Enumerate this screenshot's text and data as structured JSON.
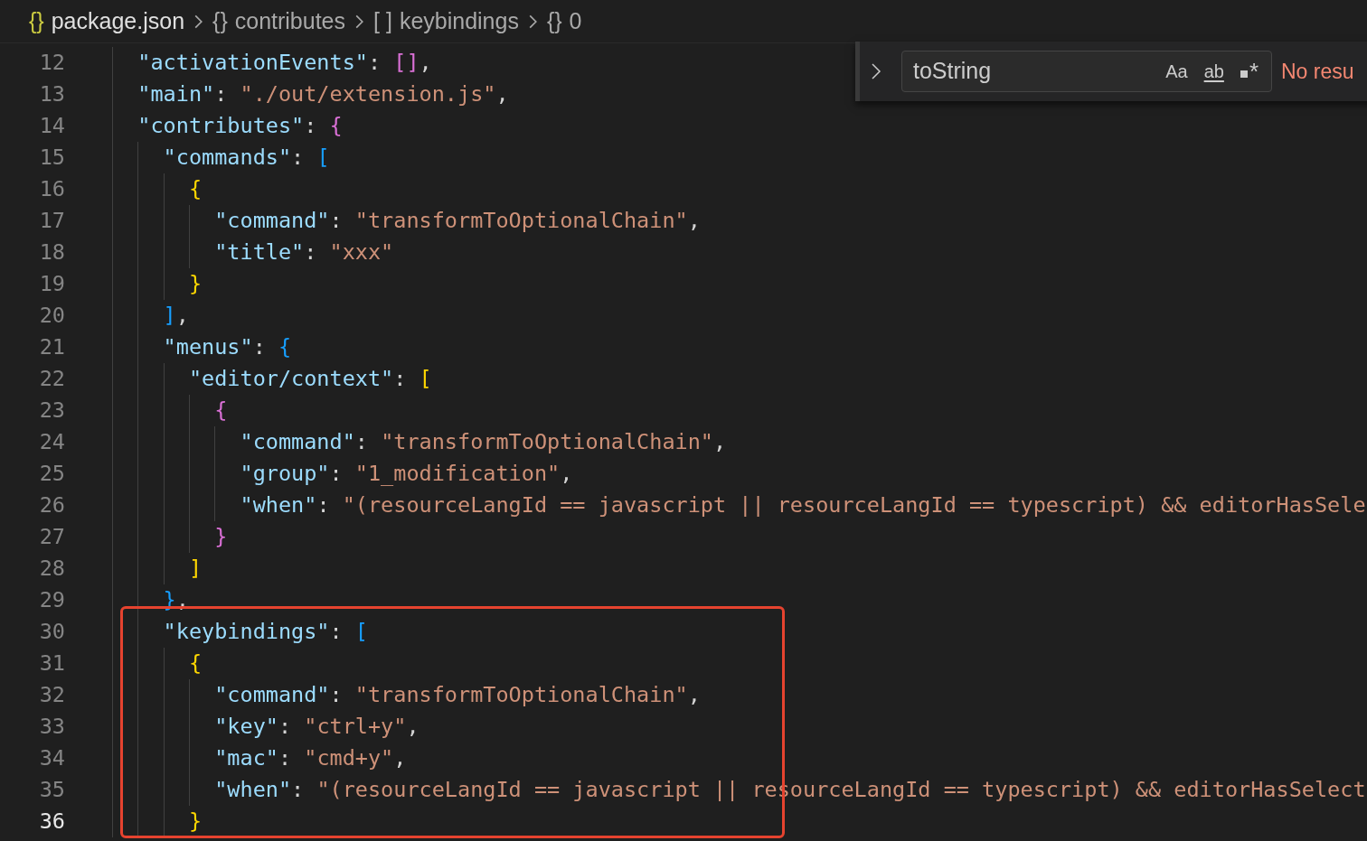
{
  "breadcrumb": [
    {
      "icon": "{}",
      "label": "package.json",
      "kind": "file"
    },
    {
      "icon": "{}",
      "label": "contributes",
      "kind": "object"
    },
    {
      "icon": "[ ]",
      "label": "keybindings",
      "kind": "array"
    },
    {
      "icon": "{}",
      "label": "0",
      "kind": "object"
    }
  ],
  "find_widget": {
    "value": "toString",
    "options": [
      {
        "label": "Aa",
        "kind": "case",
        "on": false
      },
      {
        "label": "ab",
        "kind": "word",
        "on": false
      },
      {
        "label": "*",
        "kind": "regex",
        "on": false
      }
    ],
    "status": "No resu"
  },
  "lines": [
    {
      "number": "12",
      "current": false,
      "tokens": [
        {
          "kind": "key",
          "text": "\"activationEvents\""
        },
        {
          "kind": "punct",
          "text": ": "
        },
        {
          "kind": "bracket",
          "text": "[]",
          "color": "#da70d6"
        },
        {
          "kind": "punct",
          "text": ","
        }
      ]
    },
    {
      "number": "13",
      "current": false,
      "tokens": [
        {
          "kind": "key",
          "text": "\"main\""
        },
        {
          "kind": "punct",
          "text": ": "
        },
        {
          "kind": "string",
          "text": "\"./out/extension.js\""
        },
        {
          "kind": "punct",
          "text": ","
        }
      ]
    },
    {
      "number": "14",
      "current": false,
      "tokens": [
        {
          "kind": "key",
          "text": "\"contributes\""
        },
        {
          "kind": "punct",
          "text": ": "
        },
        {
          "kind": "bracket",
          "text": "{",
          "color": "#da70d6"
        }
      ]
    },
    {
      "number": "15",
      "current": false,
      "tokens": [
        {
          "kind": "key",
          "text": "\"commands\""
        },
        {
          "kind": "punct",
          "text": ": "
        },
        {
          "kind": "bracket",
          "text": "[",
          "color": "#179fff"
        }
      ]
    },
    {
      "number": "16",
      "current": false,
      "tokens": [
        {
          "kind": "bracket",
          "text": "{",
          "color": "#ffd700"
        }
      ]
    },
    {
      "number": "17",
      "current": false,
      "tokens": [
        {
          "kind": "key",
          "text": "\"command\""
        },
        {
          "kind": "punct",
          "text": ": "
        },
        {
          "kind": "string",
          "text": "\"transformToOptionalChain\""
        },
        {
          "kind": "punct",
          "text": ","
        }
      ]
    },
    {
      "number": "18",
      "current": false,
      "tokens": [
        {
          "kind": "key",
          "text": "\"title\""
        },
        {
          "kind": "punct",
          "text": ": "
        },
        {
          "kind": "string",
          "text": "\"xxx\""
        }
      ]
    },
    {
      "number": "19",
      "current": false,
      "tokens": [
        {
          "kind": "bracket",
          "text": "}",
          "color": "#ffd700"
        }
      ]
    },
    {
      "number": "20",
      "current": false,
      "tokens": [
        {
          "kind": "bracket",
          "text": "]",
          "color": "#179fff"
        },
        {
          "kind": "punct",
          "text": ","
        }
      ]
    },
    {
      "number": "21",
      "current": false,
      "tokens": [
        {
          "kind": "key",
          "text": "\"menus\""
        },
        {
          "kind": "punct",
          "text": ": "
        },
        {
          "kind": "bracket",
          "text": "{",
          "color": "#179fff"
        }
      ]
    },
    {
      "number": "22",
      "current": false,
      "tokens": [
        {
          "kind": "key",
          "text": "\"editor/context\""
        },
        {
          "kind": "punct",
          "text": ": "
        },
        {
          "kind": "bracket",
          "text": "[",
          "color": "#ffd700"
        }
      ]
    },
    {
      "number": "23",
      "current": false,
      "tokens": [
        {
          "kind": "bracket",
          "text": "{",
          "color": "#da70d6"
        }
      ]
    },
    {
      "number": "24",
      "current": false,
      "tokens": [
        {
          "kind": "key",
          "text": "\"command\""
        },
        {
          "kind": "punct",
          "text": ": "
        },
        {
          "kind": "string",
          "text": "\"transformToOptionalChain\""
        },
        {
          "kind": "punct",
          "text": ","
        }
      ]
    },
    {
      "number": "25",
      "current": false,
      "tokens": [
        {
          "kind": "key",
          "text": "\"group\""
        },
        {
          "kind": "punct",
          "text": ": "
        },
        {
          "kind": "string",
          "text": "\"1_modification\""
        },
        {
          "kind": "punct",
          "text": ","
        }
      ]
    },
    {
      "number": "26",
      "current": false,
      "tokens": [
        {
          "kind": "key",
          "text": "\"when\""
        },
        {
          "kind": "punct",
          "text": ": "
        },
        {
          "kind": "string",
          "text": "\"(resourceLangId == javascript || resourceLangId == typescript) && editorHasSele"
        }
      ]
    },
    {
      "number": "27",
      "current": false,
      "tokens": [
        {
          "kind": "bracket",
          "text": "}",
          "color": "#da70d6"
        }
      ]
    },
    {
      "number": "28",
      "current": false,
      "tokens": [
        {
          "kind": "bracket",
          "text": "]",
          "color": "#ffd700"
        }
      ]
    },
    {
      "number": "29",
      "current": false,
      "tokens": [
        {
          "kind": "bracket",
          "text": "}",
          "color": "#179fff"
        },
        {
          "kind": "punct",
          "text": ","
        }
      ]
    },
    {
      "number": "30",
      "current": false,
      "tokens": [
        {
          "kind": "key",
          "text": "\"keybindings\""
        },
        {
          "kind": "punct",
          "text": ": "
        },
        {
          "kind": "bracket",
          "text": "[",
          "color": "#179fff"
        }
      ]
    },
    {
      "number": "31",
      "current": false,
      "tokens": [
        {
          "kind": "bracket",
          "text": "{",
          "color": "#ffd700"
        }
      ]
    },
    {
      "number": "32",
      "current": false,
      "tokens": [
        {
          "kind": "key",
          "text": "\"command\""
        },
        {
          "kind": "punct",
          "text": ": "
        },
        {
          "kind": "string",
          "text": "\"transformToOptionalChain\""
        },
        {
          "kind": "punct",
          "text": ","
        }
      ]
    },
    {
      "number": "33",
      "current": false,
      "tokens": [
        {
          "kind": "key",
          "text": "\"key\""
        },
        {
          "kind": "punct",
          "text": ": "
        },
        {
          "kind": "string",
          "text": "\"ctrl+y\""
        },
        {
          "kind": "punct",
          "text": ","
        }
      ]
    },
    {
      "number": "34",
      "current": false,
      "tokens": [
        {
          "kind": "key",
          "text": "\"mac\""
        },
        {
          "kind": "punct",
          "text": ": "
        },
        {
          "kind": "string",
          "text": "\"cmd+y\""
        },
        {
          "kind": "punct",
          "text": ","
        }
      ]
    },
    {
      "number": "35",
      "current": false,
      "tokens": [
        {
          "kind": "key",
          "text": "\"when\""
        },
        {
          "kind": "punct",
          "text": ": "
        },
        {
          "kind": "string",
          "text": "\"(resourceLangId == javascript || resourceLangId == typescript) && editorHasSelect"
        }
      ]
    },
    {
      "number": "36",
      "current": true,
      "tokens": [
        {
          "kind": "bracket",
          "text": "}",
          "color": "#ffd700"
        }
      ]
    }
  ]
}
